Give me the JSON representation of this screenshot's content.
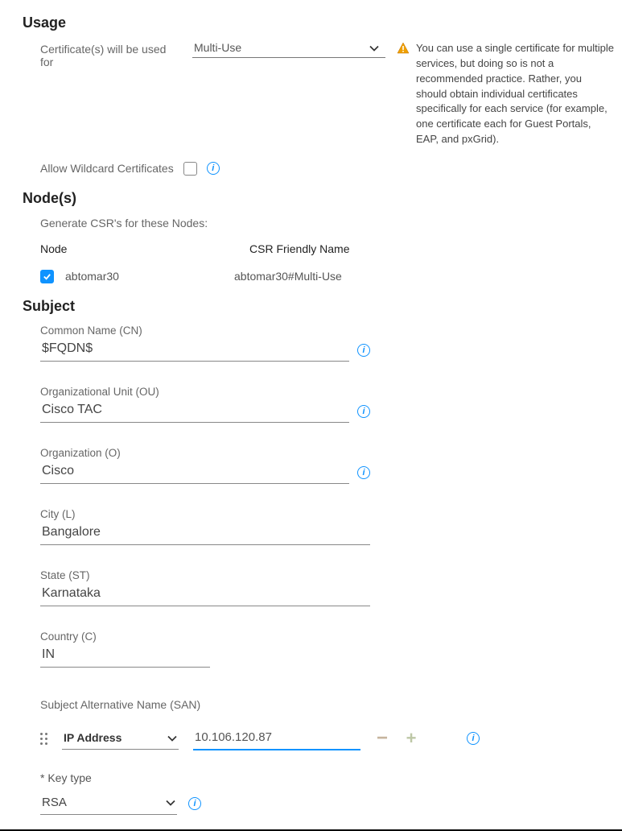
{
  "usage": {
    "heading": "Usage",
    "label": "Certificate(s) will be used for",
    "select_value": "Multi-Use",
    "warning_text": "You can use a single certificate for multiple services, but doing so is not a recommended practice. Rather, you should obtain individual certificates specifically for each service (for example, one certificate each for Guest Portals, EAP, and pxGrid).",
    "wildcard_label": "Allow Wildcard Certificates"
  },
  "nodes": {
    "heading": "Node(s)",
    "desc": "Generate CSR's for these Nodes:",
    "col_node": "Node",
    "col_csr": "CSR Friendly Name",
    "rows": [
      {
        "name": "abtomar30",
        "csr": "abtomar30#Multi-Use"
      }
    ]
  },
  "subject": {
    "heading": "Subject",
    "fields": {
      "cn": {
        "label": "Common Name (CN)",
        "value": "$FQDN$"
      },
      "ou": {
        "label": "Organizational Unit (OU)",
        "value": "Cisco TAC"
      },
      "o": {
        "label": "Organization (O)",
        "value": "Cisco"
      },
      "l": {
        "label": "City (L)",
        "value": "Bangalore"
      },
      "st": {
        "label": "State (ST)",
        "value": "Karnataka"
      },
      "c": {
        "label": "Country (C)",
        "value": "IN"
      }
    },
    "san": {
      "label": "Subject Alternative Name (SAN)",
      "type": "IP Address",
      "value": "10.106.120.87"
    },
    "key": {
      "label": "* Key type",
      "value": "RSA"
    }
  }
}
